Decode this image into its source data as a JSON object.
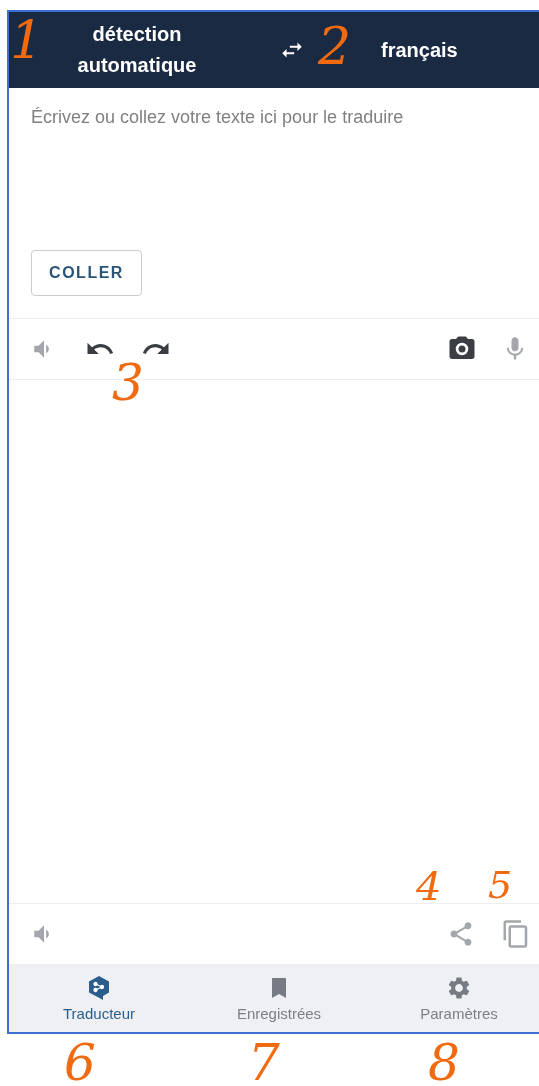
{
  "header": {
    "source_language": "détection automatique",
    "target_language": "français"
  },
  "source": {
    "placeholder": "Écrivez ou collez votre texte ici pour le traduire",
    "paste_button": "COLLER"
  },
  "input_toolbar": [
    {
      "kind": "speaker",
      "disabled": true
    },
    {
      "kind": "undo",
      "disabled": false
    },
    {
      "kind": "redo",
      "disabled": false
    },
    {
      "kind": "camera",
      "disabled": false
    },
    {
      "kind": "microphone",
      "disabled": true
    }
  ],
  "output_toolbar": [
    {
      "kind": "speaker",
      "disabled": true
    },
    {
      "kind": "share",
      "disabled": true
    },
    {
      "kind": "copy",
      "disabled": true
    }
  ],
  "bottom_nav": [
    {
      "kind": "translator",
      "label": "Traducteur",
      "selected": true
    },
    {
      "kind": "saved",
      "label": "Enregistrées",
      "selected": false
    },
    {
      "kind": "settings",
      "label": "Paramètres",
      "selected": false
    }
  ],
  "annotations": [
    {
      "text": "1"
    },
    {
      "text": "2"
    },
    {
      "text": "3"
    },
    {
      "text": "4"
    },
    {
      "text": "5"
    },
    {
      "text": "6"
    },
    {
      "text": "7"
    },
    {
      "text": "8"
    }
  ]
}
